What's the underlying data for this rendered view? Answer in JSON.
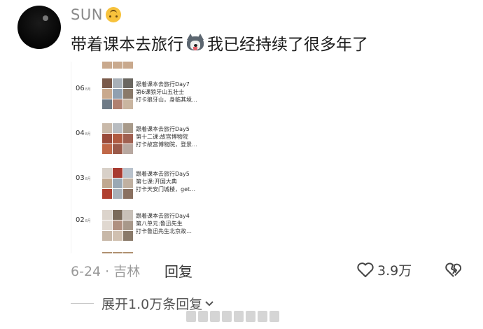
{
  "user": {
    "name": "SUN",
    "emoji_icon": "upside-down-face-icon"
  },
  "comment": {
    "text_before": "带着课本去旅行",
    "emoji_icon": "husky-dog-icon",
    "text_after": "我已经持续了很多年了"
  },
  "screenshot": {
    "entries": [
      {
        "day": "06",
        "unit": "8月",
        "title": "跟着课本去旅行Day7",
        "subtitle": "第6课狼牙山五壮士",
        "desc": "打卡狼牙山，身临其境…",
        "thumbs": [
          "#7a5a4a",
          "#a8b0b8",
          "#6a6660",
          "#c9a98d",
          "#90a0b0",
          "#8a7a6a",
          "#6e7a86",
          "#b08070",
          "#c9b5a0"
        ]
      },
      {
        "day": "04",
        "unit": "8月",
        "title": "跟着课本去旅行Day5",
        "subtitle": "第十二课:故宫博物院",
        "desc": "打卡故宫博物院，登景…",
        "thumbs": [
          "#c9b9a9",
          "#b8bcc0",
          "#a89a8a",
          "#9a4a3a",
          "#b05a40",
          "#a06050",
          "#c06848",
          "#9a5a4a",
          "#b8a8a0"
        ]
      },
      {
        "day": "03",
        "unit": "8月",
        "title": "跟着课本去旅行Day5",
        "subtitle": "第七课:开国大典",
        "desc": "打卡天安门城楼，get…",
        "thumbs": [
          "#d8d0c8",
          "#a83a30",
          "#b9c2cc",
          "#c0a890",
          "#9aa8b4",
          "#c0b0a0",
          "#b04030",
          "#a8b0b8",
          "#8a7060"
        ]
      },
      {
        "day": "02",
        "unit": "8月",
        "title": "跟着课本去旅行Day4",
        "subtitle": "第八单元:鲁迅先生",
        "desc": "打卡鲁迅先生北京故…",
        "thumbs": [
          "#dcd4cc",
          "#7a6a5a",
          "#c8c0b8",
          "#e0d8d0",
          "#b09080",
          "#a8988a",
          "#c8b8a8",
          "#d0c0b0",
          "#8a7a6a"
        ]
      }
    ]
  },
  "footer": {
    "date": "6-24",
    "location": "吉林",
    "separator": "·",
    "reply_label": "回复",
    "like_count": "3.9万",
    "like_icon": "heart-outline-icon",
    "dislike_icon": "broken-heart-icon"
  },
  "expand": {
    "label": "展开1.0万条回复",
    "icon": "chevron-down-icon"
  }
}
